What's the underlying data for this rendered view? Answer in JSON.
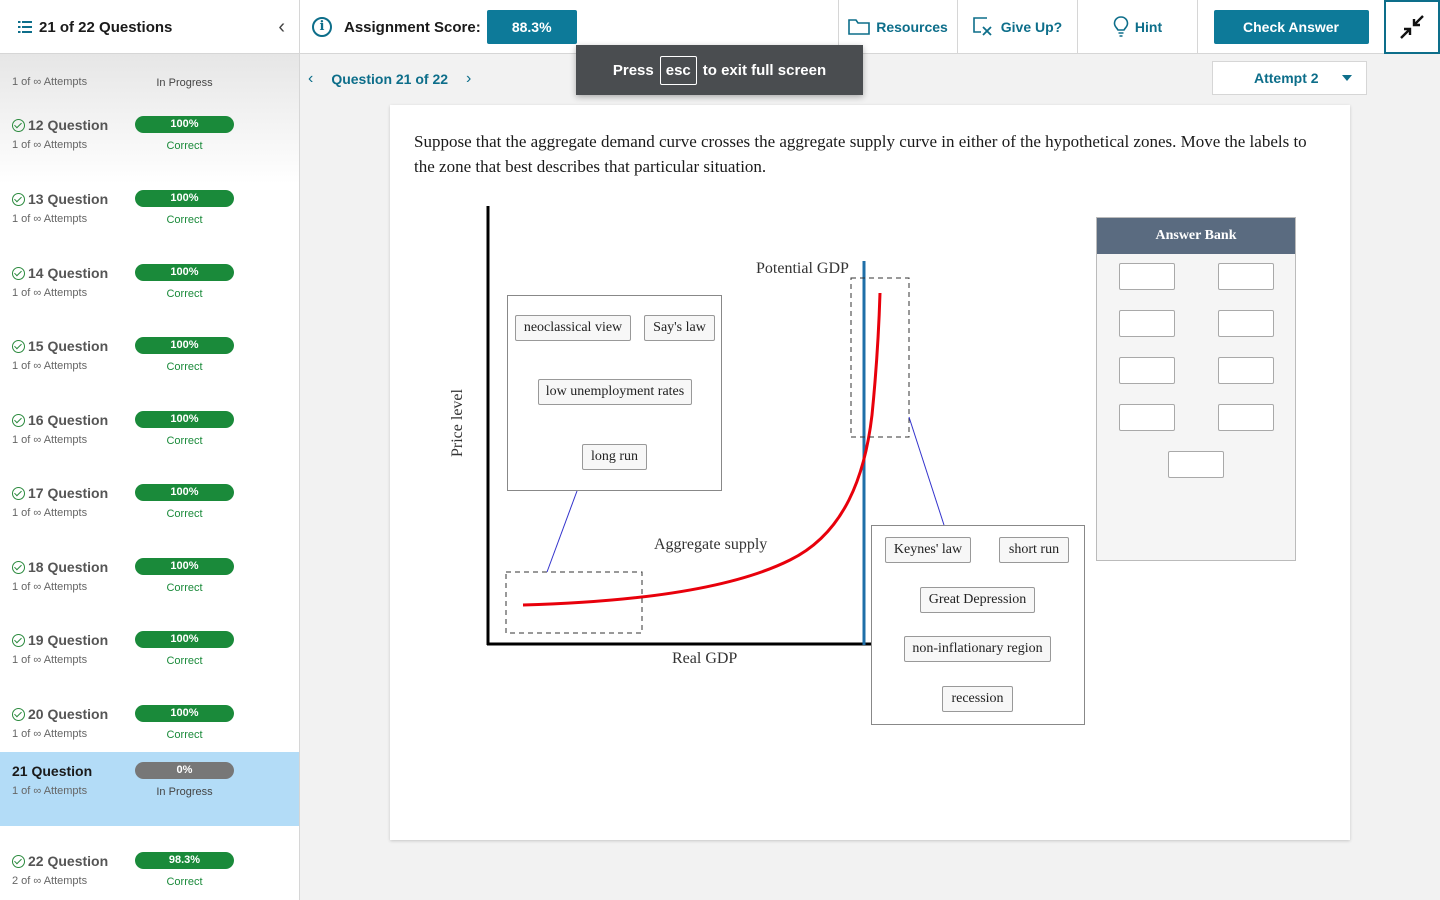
{
  "topbar": {
    "question_count": "21 of 22 Questions",
    "score_label": "Assignment Score:",
    "score_value": "88.3%",
    "resources": "Resources",
    "give_up": "Give Up?",
    "hint": "Hint",
    "check_answer": "Check Answer",
    "icons": {
      "list": "list-icon",
      "collapse": "chevron-left-icon",
      "info": "info-icon",
      "resources": "folder-icon",
      "give_up": "give-up-icon",
      "hint": "lightbulb-icon",
      "exit_fullscreen": "exit-fullscreen-icon"
    }
  },
  "sidebar": {
    "items": [
      {
        "title": "",
        "attempts": "1 of ∞ Attempts",
        "pct": "",
        "status": "In Progress"
      },
      {
        "title": "12 Question",
        "attempts": "1 of ∞ Attempts",
        "pct": "100%",
        "status": "Correct"
      },
      {
        "title": "13 Question",
        "attempts": "1 of ∞ Attempts",
        "pct": "100%",
        "status": "Correct"
      },
      {
        "title": "14 Question",
        "attempts": "1 of ∞ Attempts",
        "pct": "100%",
        "status": "Correct"
      },
      {
        "title": "15 Question",
        "attempts": "1 of ∞ Attempts",
        "pct": "100%",
        "status": "Correct"
      },
      {
        "title": "16 Question",
        "attempts": "1 of ∞ Attempts",
        "pct": "100%",
        "status": "Correct"
      },
      {
        "title": "17 Question",
        "attempts": "1 of ∞ Attempts",
        "pct": "100%",
        "status": "Correct"
      },
      {
        "title": "18 Question",
        "attempts": "1 of ∞ Attempts",
        "pct": "100%",
        "status": "Correct"
      },
      {
        "title": "19 Question",
        "attempts": "1 of ∞ Attempts",
        "pct": "100%",
        "status": "Correct"
      },
      {
        "title": "20 Question",
        "attempts": "1 of ∞ Attempts",
        "pct": "100%",
        "status": "Correct"
      },
      {
        "title": "21 Question",
        "attempts": "1 of ∞ Attempts",
        "pct": "0%",
        "status": "In Progress"
      },
      {
        "title": "22 Question",
        "attempts": "2 of ∞ Attempts",
        "pct": "98.3%",
        "status": "Correct"
      }
    ]
  },
  "nav": {
    "question_label": "Question 21 of 22",
    "attempt": "Attempt 2"
  },
  "toast": {
    "press": "Press",
    "key": "esc",
    "rest": "to exit full screen"
  },
  "question": {
    "prompt": "Suppose that the aggregate demand curve crosses the aggregate supply curve in either of the hypothetical zones. Move the labels to the zone that best describes that particular situation.",
    "graph": {
      "y_axis_label": "Price level",
      "x_axis_label": "Real GDP",
      "potential_gdp_label": "Potential GDP",
      "aggregate_supply_label": "Aggregate supply",
      "colors": {
        "supply_curve": "#e8000b",
        "potential_line": "#1f6fa8",
        "connector": "#3333cc"
      }
    },
    "left_zone_labels": [
      "neoclassical view",
      "Say's law",
      "low unemployment rates",
      "long run"
    ],
    "right_zone_labels": [
      "Keynes' law",
      "short run",
      "Great Depression",
      "non-inflationary region",
      "recession"
    ],
    "answer_bank": {
      "title": "Answer Bank",
      "empty_slots": 9
    }
  }
}
